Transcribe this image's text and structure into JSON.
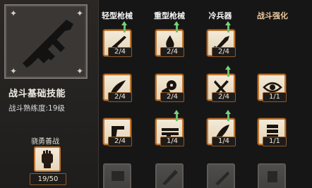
{
  "panel": {
    "title": "战斗基础技能",
    "level_text": "战斗熟练度:19级",
    "passive": {
      "label": "骁勇善战",
      "count": "19/50"
    }
  },
  "columns": [
    {
      "label": "轻型枪械"
    },
    {
      "label": "重型枪械"
    },
    {
      "label": "冷兵器"
    },
    {
      "label": "战斗强化"
    }
  ],
  "skills": [
    {
      "icon": "rifle-icon",
      "count": "2/4",
      "upgrade": true
    },
    {
      "icon": "fire-icon",
      "count": "2/4",
      "upgrade": true
    },
    {
      "icon": "blade-icon",
      "count": "2/4",
      "upgrade": true
    },
    {
      "icon": "knife-icon",
      "count": "2/4",
      "upgrade": false
    },
    {
      "icon": "revolver-icon",
      "count": "2/4",
      "upgrade": false
    },
    {
      "icon": "crossed-blades-icon",
      "count": "2/4",
      "upgrade": true
    },
    {
      "icon": "eye-icon",
      "count": "1/1",
      "upgrade": false
    },
    {
      "icon": "pistol-icon",
      "count": "2/4",
      "upgrade": false
    },
    {
      "icon": "minigun-icon",
      "count": "1/4",
      "upgrade": true
    },
    {
      "icon": "sword-icon",
      "count": "1/4",
      "upgrade": true
    },
    {
      "icon": "armor-icon",
      "count": "1/1",
      "upgrade": false
    }
  ],
  "locked_skills": [
    {
      "icon": "locked-skill-icon"
    },
    {
      "icon": "locked-skill-icon"
    },
    {
      "icon": "locked-skill-icon"
    },
    {
      "icon": "locked-skill-icon"
    }
  ]
}
